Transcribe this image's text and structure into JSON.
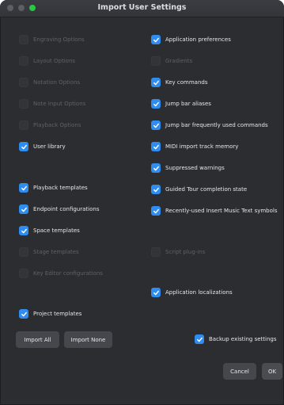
{
  "window": {
    "title": "Import User Settings"
  },
  "left_options": [
    {
      "label": "Engraving Options",
      "checked": false,
      "enabled": false
    },
    {
      "label": "Layout Options",
      "checked": false,
      "enabled": false
    },
    {
      "label": "Notation Options",
      "checked": false,
      "enabled": false
    },
    {
      "label": "Note Input Options",
      "checked": false,
      "enabled": false
    },
    {
      "label": "Playback Options",
      "checked": false,
      "enabled": false
    },
    {
      "label": "User library",
      "checked": true,
      "enabled": true
    },
    {
      "label": "Playback templates",
      "checked": true,
      "enabled": true
    },
    {
      "label": "Endpoint configurations",
      "checked": true,
      "enabled": true
    },
    {
      "label": "Space templates",
      "checked": true,
      "enabled": true
    },
    {
      "label": "Stage templates",
      "checked": false,
      "enabled": false
    },
    {
      "label": "Key Editor configurations",
      "checked": false,
      "enabled": false
    },
    {
      "label": "Project templates",
      "checked": true,
      "enabled": true
    }
  ],
  "right_options": [
    {
      "label": "Application preferences",
      "checked": true,
      "enabled": true
    },
    {
      "label": "Gradients",
      "checked": false,
      "enabled": false
    },
    {
      "label": "Key commands",
      "checked": true,
      "enabled": true
    },
    {
      "label": "Jump bar aliases",
      "checked": true,
      "enabled": true
    },
    {
      "label": "Jump bar frequently used commands",
      "checked": true,
      "enabled": true
    },
    {
      "label": "MIDI import track memory",
      "checked": true,
      "enabled": true
    },
    {
      "label": "Suppressed warnings",
      "checked": true,
      "enabled": true
    },
    {
      "label": "Guided Tour completion state",
      "checked": true,
      "enabled": true
    },
    {
      "label": "Recently-used Insert Music Text symbols",
      "checked": true,
      "enabled": true
    },
    {
      "label": "Script plug-ins",
      "checked": false,
      "enabled": false
    },
    {
      "label": "Application localizations",
      "checked": true,
      "enabled": true
    }
  ],
  "footer": {
    "import_all": "Import All",
    "import_none": "Import None",
    "backup": {
      "label": "Backup existing settings",
      "checked": true
    },
    "cancel": "Cancel",
    "ok": "OK"
  },
  "colors": {
    "accent": "#2f8df0",
    "window_bg": "#2b2d31",
    "close_light": "#28c840"
  },
  "icons": {
    "check": "checkmark-icon"
  }
}
